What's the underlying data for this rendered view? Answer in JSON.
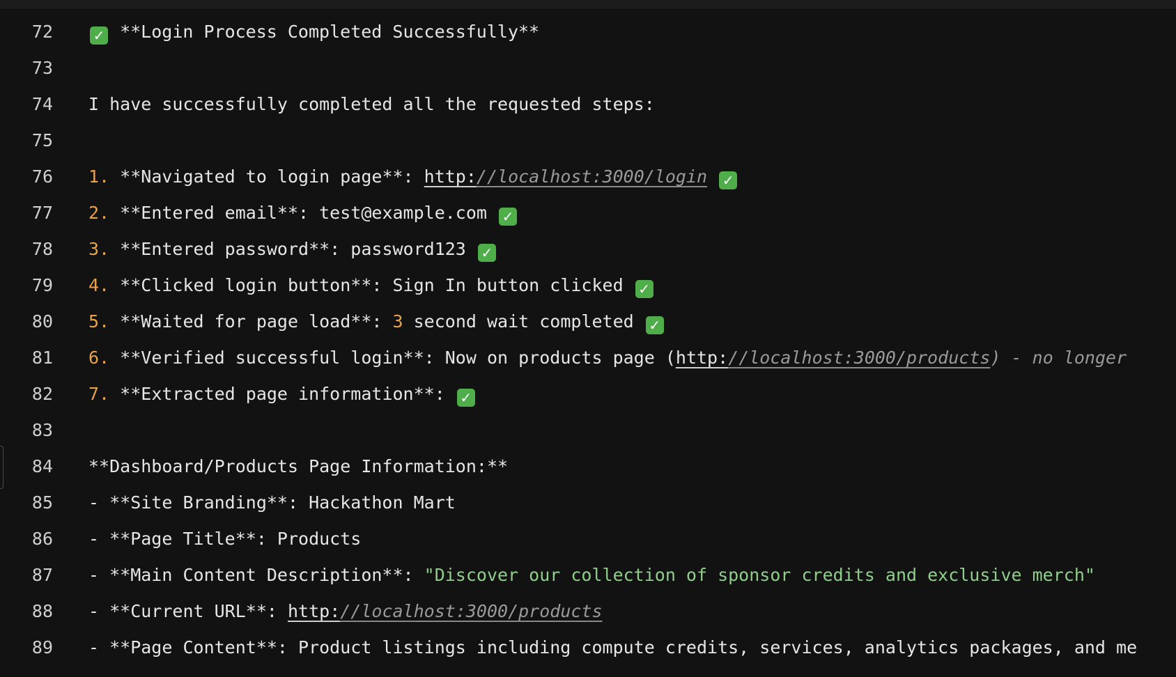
{
  "editor": {
    "check_glyph": "✓",
    "lines": [
      {
        "no": "72",
        "heading": "**Login Process Completed Successfully**"
      },
      {
        "no": "73"
      },
      {
        "no": "74",
        "text": "I have successfully completed all the requested steps:"
      },
      {
        "no": "75"
      },
      {
        "no": "76",
        "marker": "1.",
        "text": " **Navigated to login page**: ",
        "url_scheme": "http:",
        "url_rest": "//localhost:3000/login"
      },
      {
        "no": "77",
        "marker": "2.",
        "text": " **Entered email**: test@example.com "
      },
      {
        "no": "78",
        "marker": "3.",
        "text": " **Entered password**: password123 "
      },
      {
        "no": "79",
        "marker": "4.",
        "text": " **Clicked login button**: Sign In button clicked "
      },
      {
        "no": "80",
        "marker": "5.",
        "text": " **Waited for page load**: ",
        "number": "3",
        "text_after": " second wait completed "
      },
      {
        "no": "81",
        "marker": "6.",
        "text": " **Verified successful login**: Now on products page (",
        "url_scheme": "http:",
        "url_rest": "//localhost:3000/products",
        "comment": ") - no longer"
      },
      {
        "no": "82",
        "marker": "7.",
        "text": " **Extracted page information**: "
      },
      {
        "no": "83"
      },
      {
        "no": "84",
        "text": "**Dashboard/Products Page Information:**"
      },
      {
        "no": "85",
        "text": "- **Site Branding**: Hackathon Mart"
      },
      {
        "no": "86",
        "text": "- **Page Title**: Products"
      },
      {
        "no": "87",
        "text": "- **Main Content Description**: ",
        "string": "\"Discover our collection of sponsor credits and exclusive merch\""
      },
      {
        "no": "88",
        "text": "- **Current URL**: ",
        "url_scheme": "http:",
        "url_rest": "//localhost:3000/products"
      },
      {
        "no": "89",
        "text": "- **Page Content**: Product listings including compute credits, services, analytics packages, and me"
      }
    ]
  }
}
